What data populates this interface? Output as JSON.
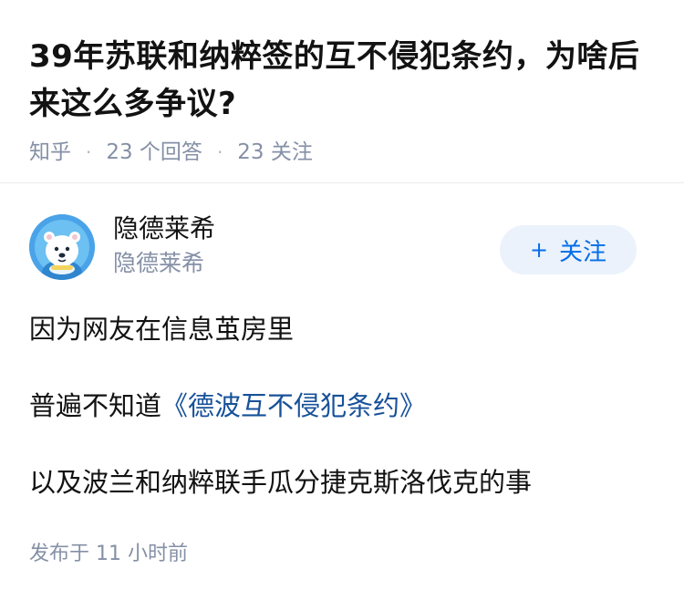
{
  "question": {
    "title": "39年苏联和纳粹签的互不侵犯条约，为啥后来这么多争议?",
    "source": "知乎",
    "answer_count": "23 个回答",
    "follower_count": "23 关注"
  },
  "answer": {
    "author": {
      "name": "隐德莱希",
      "headline": "隐德莱希"
    },
    "follow_button": {
      "plus": "+",
      "label": "关注"
    },
    "paragraphs": [
      {
        "text": "因为网友在信息茧房里"
      },
      {
        "prefix": "普遍不知道",
        "link": "《德波互不侵犯条约》"
      },
      {
        "text": "以及波兰和纳粹联手瓜分捷克斯洛伐克的事"
      }
    ],
    "publish_time": "发布于 11 小时前"
  },
  "colors": {
    "text_primary": "#121212",
    "text_secondary": "#8590a6",
    "link": "#175199",
    "accent": "#056de8",
    "follow_bg": "#ebf2fb",
    "avatar_bg": "#4aa3e8"
  },
  "icons": {
    "avatar": "polar-bear-astronaut-avatar"
  }
}
